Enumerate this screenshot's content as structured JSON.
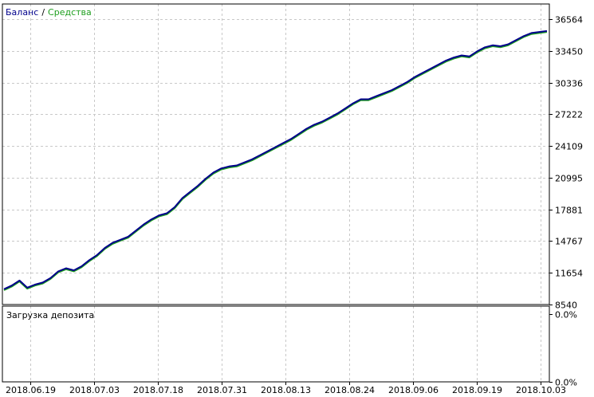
{
  "chart_data": [
    {
      "type": "line",
      "legend": [
        {
          "name": "Баланс",
          "color": "#00008b"
        },
        {
          "name": "Средства",
          "color": "#1e9e1e"
        }
      ],
      "legend_separator": "/",
      "legend_placement": "top-left",
      "grid": true,
      "y_ticks": [
        "36564",
        "33450",
        "30336",
        "27222",
        "24109",
        "20995",
        "17881",
        "14767",
        "11654",
        "8540"
      ],
      "ylim": [
        8540,
        36564
      ],
      "x_ticks": [
        "2018.06.19",
        "2018.07.03",
        "2018.07.18",
        "2018.07.31",
        "2018.08.13",
        "2018.08.24",
        "2018.09.06",
        "2018.09.19",
        "2018.10.03"
      ],
      "series": [
        {
          "name": "Баланс",
          "x": [
            0,
            1,
            2,
            3,
            4,
            5,
            6,
            7,
            8,
            9,
            10,
            11,
            12,
            13,
            14,
            15,
            16,
            17,
            18,
            19,
            20,
            21,
            22,
            23,
            24,
            25,
            26,
            27,
            28,
            29,
            30,
            31,
            32,
            33,
            34,
            35,
            36,
            37,
            38,
            39,
            40,
            41,
            42,
            43,
            44,
            45,
            46,
            47,
            48,
            49,
            50,
            51,
            52,
            53,
            54,
            55,
            56,
            57,
            58,
            59,
            60,
            61,
            62,
            63,
            64,
            65,
            66,
            67,
            68,
            69,
            70
          ],
          "y": [
            10050,
            10400,
            10900,
            10200,
            10500,
            10700,
            11150,
            11800,
            12100,
            11900,
            12300,
            12900,
            13400,
            14100,
            14600,
            14900,
            15200,
            15800,
            16400,
            16900,
            17300,
            17500,
            18100,
            19000,
            19600,
            20200,
            20900,
            21500,
            21900,
            22100,
            22200,
            22500,
            22800,
            23200,
            23600,
            24000,
            24400,
            24800,
            25300,
            25800,
            26200,
            26500,
            26900,
            27300,
            27800,
            28300,
            28700,
            28700,
            29000,
            29300,
            29600,
            30000,
            30400,
            30900,
            31300,
            31700,
            32100,
            32500,
            32800,
            33000,
            32900,
            33400,
            33800,
            34000,
            33900,
            34100,
            34500,
            34900,
            35200,
            35300,
            35400
          ]
        },
        {
          "name": "Средства",
          "x": [
            0,
            1,
            2,
            3,
            4,
            5,
            6,
            7,
            8,
            9,
            10,
            11,
            12,
            13,
            14,
            15,
            16,
            17,
            18,
            19,
            20,
            21,
            22,
            23,
            24,
            25,
            26,
            27,
            28,
            29,
            30,
            31,
            32,
            33,
            34,
            35,
            36,
            37,
            38,
            39,
            40,
            41,
            42,
            43,
            44,
            45,
            46,
            47,
            48,
            49,
            50,
            51,
            52,
            53,
            54,
            55,
            56,
            57,
            58,
            59,
            60,
            61,
            62,
            63,
            64,
            65,
            66,
            67,
            68,
            69,
            70
          ],
          "y": [
            9950,
            10300,
            10800,
            10100,
            10400,
            10600,
            11050,
            11700,
            12000,
            11800,
            12200,
            12800,
            13300,
            14000,
            14500,
            14800,
            15100,
            15700,
            16300,
            16800,
            17200,
            17400,
            18000,
            18900,
            19500,
            20100,
            20800,
            21400,
            21800,
            22000,
            22100,
            22400,
            22700,
            23100,
            23500,
            23900,
            24300,
            24700,
            25200,
            25700,
            26100,
            26400,
            26800,
            27200,
            27700,
            28200,
            28600,
            28600,
            28900,
            29200,
            29500,
            29900,
            30300,
            30800,
            31200,
            31600,
            32000,
            32400,
            32700,
            32900,
            32800,
            33300,
            33700,
            33900,
            33800,
            34000,
            34400,
            34800,
            35100,
            35200,
            35300
          ]
        }
      ]
    },
    {
      "type": "area",
      "title": "Загрузка депозита",
      "y_ticks": [
        "0.0%",
        "0.0%"
      ],
      "ylim": [
        0,
        0
      ],
      "grid": true,
      "values": []
    }
  ]
}
